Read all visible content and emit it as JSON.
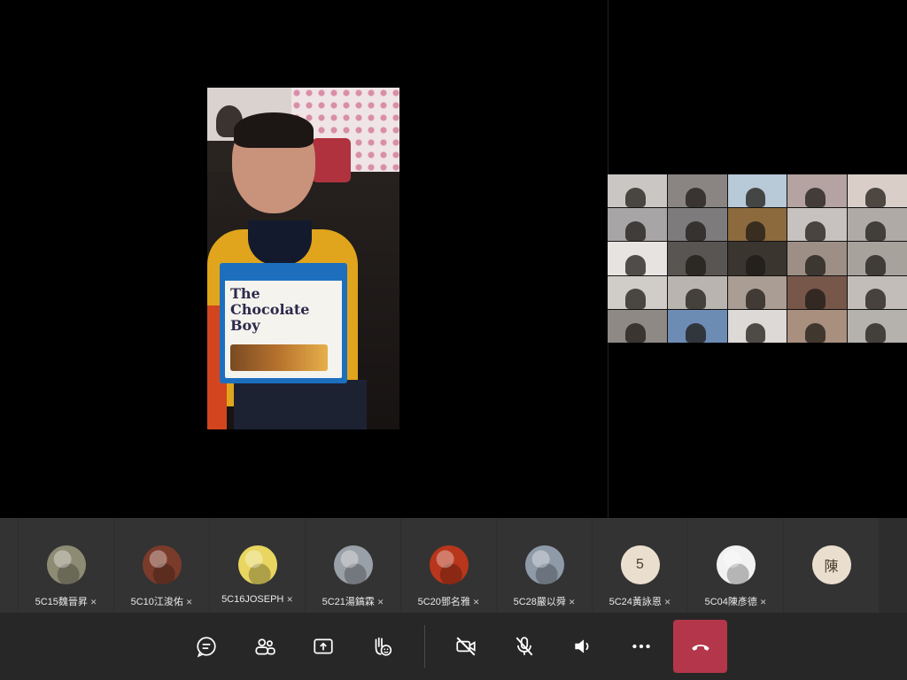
{
  "main_video": {
    "book_title_line1": "The",
    "book_title_line2": "Chocolate",
    "book_title_line3": "Boy"
  },
  "participants": [
    {
      "name": "5C15魏晉昇",
      "avatar_type": "photo",
      "avatar_color": "#8d8b74"
    },
    {
      "name": "5C10江浚佑",
      "avatar_type": "photo",
      "avatar_color": "#7b3b2a"
    },
    {
      "name": "5C16JOSEPH",
      "avatar_type": "photo",
      "avatar_color": "#e8d660"
    },
    {
      "name": "5C21湯鎬霖",
      "avatar_type": "photo",
      "avatar_color": "#9aa0a8"
    },
    {
      "name": "5C20鄧名雅",
      "avatar_type": "photo",
      "avatar_color": "#b8361b"
    },
    {
      "name": "5C28嚴以舜",
      "avatar_type": "photo",
      "avatar_color": "#8f9aa8"
    },
    {
      "name": "5C24黃詠恩",
      "avatar_type": "initial",
      "initial": "5",
      "avatar_color": "#eadfcf"
    },
    {
      "name": "5C04陳彥德",
      "avatar_type": "photo",
      "avatar_color": "#f2f2f2"
    },
    {
      "name": "",
      "avatar_type": "initial",
      "initial": "陳",
      "avatar_color": "#eadfcf"
    }
  ],
  "controls": {
    "chat_icon": "chat-icon",
    "people_icon": "people-icon",
    "share_icon": "share-screen-icon",
    "react_icon": "raise-hand-icon",
    "camera_icon": "camera-off-icon",
    "mic_icon": "mic-off-icon",
    "speaker_icon": "speaker-icon",
    "more_icon": "more-icon",
    "hangup_icon": "hang-up-icon",
    "hangup_color": "#b4364a"
  },
  "gallery": {
    "thumb_colors": [
      "#c9c6c4",
      "#8a8583",
      "#b8c9d8",
      "#b4a3a0",
      "#d9cfc8",
      "#a7a5a6",
      "#7d7b7c",
      "#8c6a3e",
      "#c7c2bf",
      "#b0aaa6",
      "#e6e3e1",
      "#585552",
      "#3b352f",
      "#9d8f85",
      "#a8a29c",
      "#d0ccc8",
      "#b9b4af",
      "#aa9d93",
      "#76574a",
      "#c2bdb9",
      "#8e8985",
      "#6c8cb4",
      "#ddd9d6",
      "#a88f7e",
      "#b5b1ad"
    ]
  }
}
